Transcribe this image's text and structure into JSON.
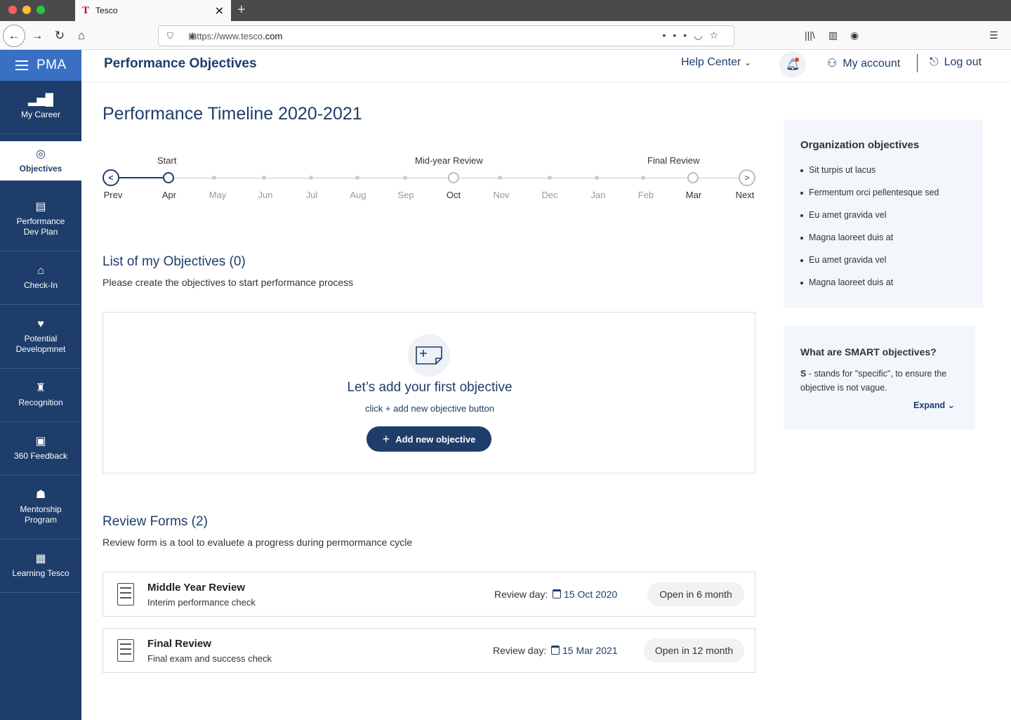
{
  "browser": {
    "tab_title": "Tesco",
    "tab_favicon": "T",
    "url_prefix": "https://www.tesco",
    "url_suffix": ".com",
    "icons": [
      "back-icon",
      "forward-icon",
      "reload-icon",
      "home-icon",
      "shield-icon",
      "lock-icon",
      "more-icon",
      "pocket-icon",
      "star-icon",
      "library-icon",
      "reader-icon",
      "profile-icon",
      "menu-icon"
    ]
  },
  "sidebar": {
    "brand": "PMA",
    "items": [
      {
        "label": "My Career",
        "icon": "bar-chart-icon"
      },
      {
        "label": "Objectives",
        "icon": "target-icon",
        "active": true
      },
      {
        "label": "Performance Dev Plan",
        "icon": "clipboard-icon"
      },
      {
        "label": "Check-In",
        "icon": "graduation-icon"
      },
      {
        "label": "Potential Developmnet",
        "icon": "heart-hands-icon"
      },
      {
        "label": "Recognition",
        "icon": "trophy-icon"
      },
      {
        "label": "360 Feedback",
        "icon": "feedback-icon"
      },
      {
        "label": "Mentorship Program",
        "icon": "mentor-icon"
      },
      {
        "label": "Learning Tesco",
        "icon": "book-icon"
      }
    ]
  },
  "header": {
    "title": "Performance Objectives",
    "help": "Help Center",
    "account": "My account",
    "logout": "Log out"
  },
  "timeline": {
    "title": "Performance Timeline 2020-2021",
    "labels": {
      "start": "Start",
      "mid": "Mid-year Review",
      "final": "Final Review"
    },
    "prev": "Prev",
    "next": "Next",
    "months": [
      "Apr",
      "May",
      "Jun",
      "Jul",
      "Aug",
      "Sep",
      "Oct",
      "Nov",
      "Dec",
      "Jan",
      "Feb",
      "Mar"
    ]
  },
  "objectives": {
    "title": "List of my Objectives (0)",
    "subtitle": "Please create the objectives to start performance process",
    "empty_title": "Let’s add your first objective",
    "empty_sub": "click + add new objective button",
    "add_button": "Add new objective"
  },
  "reviews": {
    "title": "Review Forms (2)",
    "subtitle": "Review form is a tool to evaluete a progress during permormance cycle",
    "day_label": "Review day:",
    "items": [
      {
        "name": "Middle Year Review",
        "desc": "Interim performance check",
        "date": "15 Oct 2020",
        "status": "Open in 6 month"
      },
      {
        "name": "Final Review",
        "desc": "Final exam and success check",
        "date": "15 Mar 2021",
        "status": "Open in 12 month"
      }
    ]
  },
  "org": {
    "title": "Organization objectives",
    "items": [
      "Sit turpis ut lacus",
      "Fermentum orci pellentesque sed",
      "Eu amet gravida vel",
      "Magna laoreet duis at",
      "Eu amet gravida vel",
      "Magna laoreet duis at"
    ]
  },
  "smart": {
    "title": "What are SMART objectives?",
    "letter": "S",
    "text": " - stands for \"specific\", to ensure the objective is not vague.",
    "expand": "Expand"
  }
}
